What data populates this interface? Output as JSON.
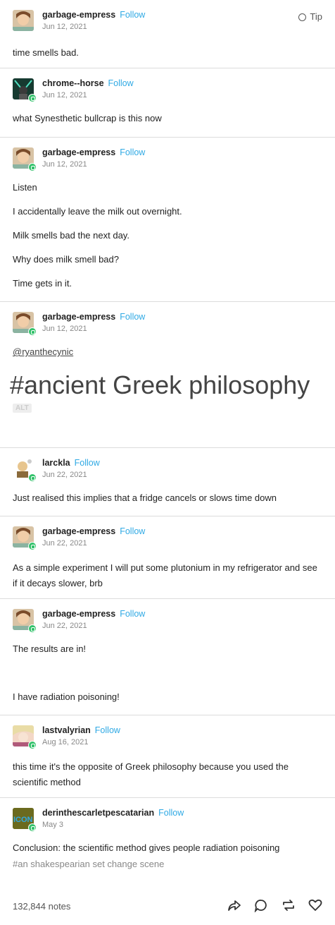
{
  "tip_label": "Tip",
  "follow_label": "Follow",
  "posts": [
    {
      "user": "garbage-empress",
      "date": "Jun 12, 2021",
      "lines": [
        "time smells bad."
      ]
    },
    {
      "user": "chrome--horse",
      "date": "Jun 12, 2021",
      "lines": [
        "what Synesthetic bullcrap is this now"
      ]
    },
    {
      "user": "garbage-empress",
      "date": "Jun 12, 2021",
      "lines": [
        "Listen",
        "I accidentally leave the milk out overnight.",
        "Milk smells bad the next day.",
        "Why does milk smell bad?",
        "Time gets in it."
      ]
    },
    {
      "user": "garbage-empress",
      "date": "Jun 12, 2021",
      "mention": "@ryanthecynic",
      "big_text": "#ancient Greek philosophy",
      "alt_label": "ALT"
    },
    {
      "user": "larckla",
      "date": "Jun 22, 2021",
      "lines": [
        "Just realised this implies that a fridge cancels or slows time down"
      ]
    },
    {
      "user": "garbage-empress",
      "date": "Jun 22, 2021",
      "lines": [
        "As a simple experiment I will put some plutonium in my refrigerator and see if it decays slower, brb"
      ]
    },
    {
      "user": "garbage-empress",
      "date": "Jun 22, 2021",
      "lines": [
        "The results are in!",
        "I have radiation poisoning!"
      ]
    },
    {
      "user": "lastvalyrian",
      "date": "Aug 16, 2021",
      "lines": [
        "this time it's the opposite of Greek philosophy because you used the scientific method"
      ]
    },
    {
      "user": "derinthescarletpescatarian",
      "date": "May 3",
      "lines": [
        "Conclusion: the scientific method gives people radiation poisoning"
      ],
      "tags": "#an shakespearian set change scene",
      "avatar_text": "ICON"
    }
  ],
  "notes": "132,844 notes",
  "colors": {
    "follow": "#2fa9e4",
    "badge": "#33c26b",
    "text": "#222222",
    "muted": "#888888"
  }
}
